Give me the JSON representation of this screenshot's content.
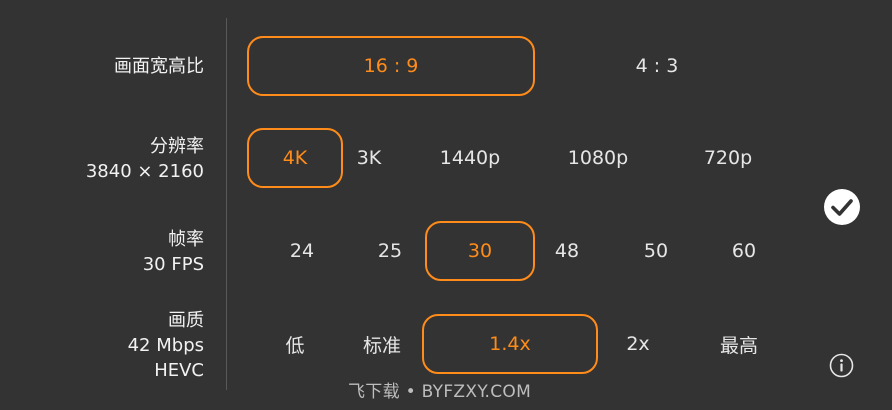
{
  "accent_color": "#ff8c1a",
  "aspect": {
    "label": "画面宽高比",
    "options": [
      "16 : 9",
      "4 : 3"
    ],
    "selected": "16 : 9"
  },
  "resolution": {
    "label": "分辨率",
    "sub": "3840 × 2160",
    "options": [
      "4K",
      "3K",
      "1440p",
      "1080p",
      "720p"
    ],
    "selected": "4K"
  },
  "framerate": {
    "label": "帧率",
    "sub": "30 FPS",
    "options": [
      "24",
      "25",
      "30",
      "48",
      "50",
      "60"
    ],
    "selected": "30"
  },
  "quality": {
    "label": "画质",
    "sub1": "42 Mbps",
    "sub2": "HEVC",
    "options": [
      "低",
      "标准",
      "1.4x",
      "2x",
      "最高"
    ],
    "selected": "1.4x"
  },
  "icons": {
    "confirm": "check-circle-icon",
    "info": "info-icon"
  },
  "watermark": "飞下载 • BYFZXY.COM"
}
